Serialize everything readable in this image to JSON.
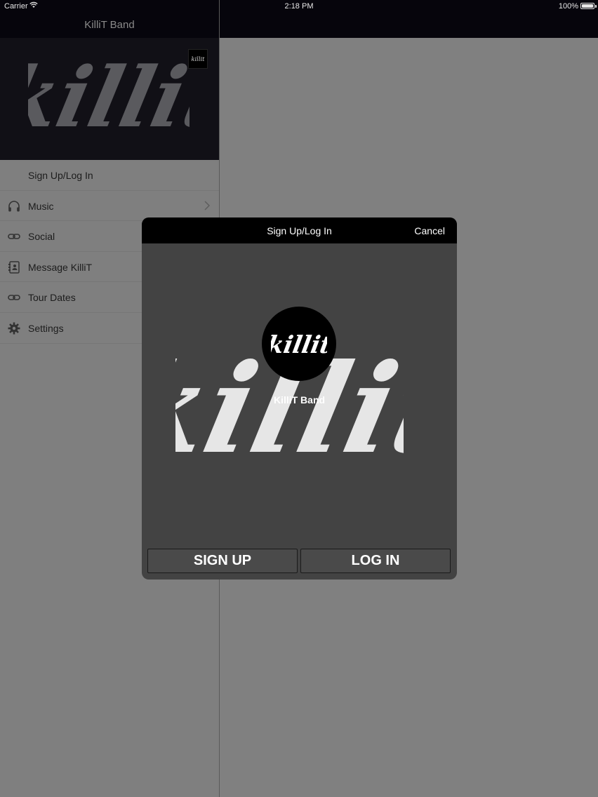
{
  "status_bar": {
    "carrier": "Carrier",
    "time": "2:18 PM",
    "battery": "100%",
    "battery_level": 1.0
  },
  "nav": {
    "title": "KilliT Band"
  },
  "sidebar": {
    "header_logo_text": "killit",
    "header_thumb_text": "killit",
    "items": [
      {
        "label": "Sign Up/Log In",
        "icon": "none",
        "chevron": false
      },
      {
        "label": "Music",
        "icon": "headphones-icon",
        "chevron": true
      },
      {
        "label": "Social",
        "icon": "link-icon",
        "chevron": false
      },
      {
        "label": "Message KilliT",
        "icon": "contact-book-icon",
        "chevron": false
      },
      {
        "label": "Tour Dates",
        "icon": "link-icon",
        "chevron": false
      },
      {
        "label": "Settings",
        "icon": "gear-icon",
        "chevron": false
      }
    ]
  },
  "modal": {
    "title": "Sign Up/Log In",
    "cancel": "Cancel",
    "background_logo_text": "killit",
    "avatar_logo_text": "killit",
    "name": "KilliT Band",
    "signup_label": "SIGN UP",
    "login_label": "LOG IN"
  },
  "colors": {
    "dim_overlay": "#808080",
    "bar": "#000000",
    "modal_bg": "#434343",
    "logo_light": "#e6e6e6"
  }
}
